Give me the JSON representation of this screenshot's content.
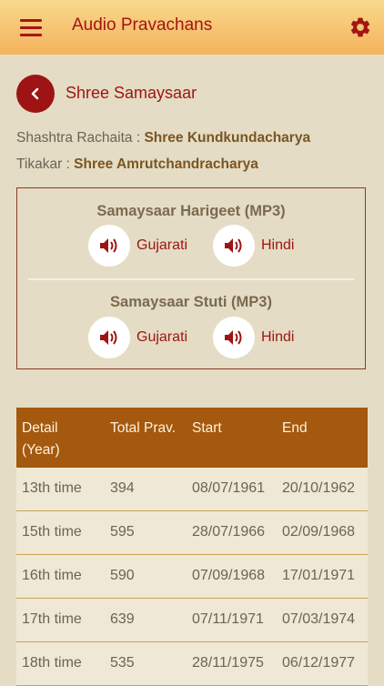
{
  "appbar": {
    "title": "Audio Pravachans",
    "menu_icon": "hamburger-menu-icon",
    "settings_icon": "gear-icon"
  },
  "header": {
    "back_icon": "chevron-left-icon",
    "title": "Shree Samaysaar"
  },
  "meta": {
    "rachaita_label": "Shashtra Rachaita : ",
    "rachaita_value": "Shree Kundkundacharya",
    "tikakar_label": "Tikakar : ",
    "tikakar_value": "Shree Amrutchandracharya"
  },
  "audio_sections": [
    {
      "title": "Samaysaar Harigeet (MP3)",
      "buttons": [
        {
          "label": "Gujarati",
          "icon": "speaker-icon"
        },
        {
          "label": "Hindi",
          "icon": "speaker-icon"
        }
      ]
    },
    {
      "title": "Samaysaar Stuti (MP3)",
      "buttons": [
        {
          "label": "Gujarati",
          "icon": "speaker-icon"
        },
        {
          "label": "Hindi",
          "icon": "speaker-icon"
        }
      ]
    }
  ],
  "table": {
    "headers": [
      "Detail",
      "(Year)",
      "Total Prav.",
      "Start",
      "End"
    ],
    "rows": [
      [
        "13th time",
        "394",
        "08/07/1961",
        "20/10/1962"
      ],
      [
        "15th time",
        "595",
        "28/07/1966",
        "02/09/1968"
      ],
      [
        "16th time",
        "590",
        "07/09/1968",
        "17/01/1971"
      ],
      [
        "17th time",
        "639",
        "07/11/1971",
        "07/03/1974"
      ],
      [
        "18th time",
        "535",
        "28/11/1975",
        "06/12/1977"
      ]
    ]
  },
  "colors": {
    "accent": "#9E1414",
    "header_bg": "#A4590E",
    "background": "#E4DCC4"
  }
}
